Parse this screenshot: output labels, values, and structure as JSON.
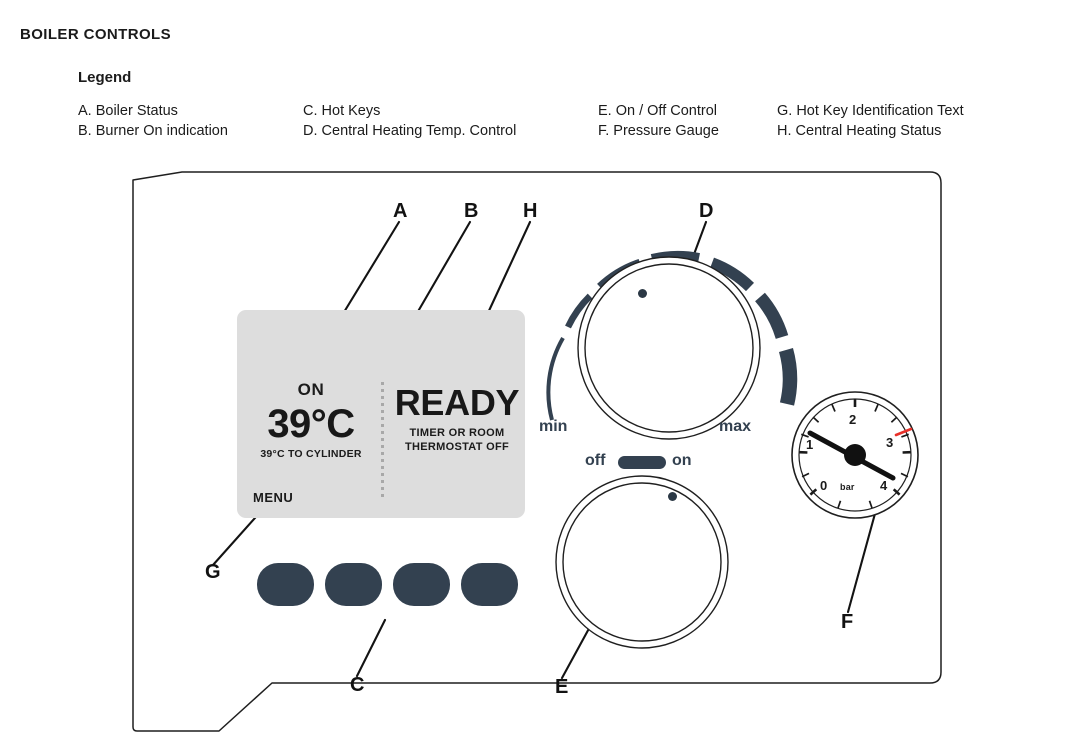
{
  "page": {
    "title": "BOILER CONTROLS",
    "legend_heading": "Legend"
  },
  "legend": {
    "columns": [
      {
        "items": [
          "A. Boiler Status",
          "B. Burner On indication"
        ]
      },
      {
        "items": [
          "C. Hot Keys",
          "D. Central Heating Temp. Control"
        ]
      },
      {
        "items": [
          "E. On / Off Control",
          "F. Pressure Gauge"
        ]
      },
      {
        "items": [
          "G. Hot Key Identification Text",
          "H. Central Heating Status"
        ]
      }
    ]
  },
  "callouts": [
    {
      "letter": "A",
      "target": "boiler-status-icon"
    },
    {
      "letter": "B",
      "target": "burner-on-indication"
    },
    {
      "letter": "C",
      "target": "hot-keys"
    },
    {
      "letter": "D",
      "target": "central-heating-temp-control"
    },
    {
      "letter": "E",
      "target": "on-off-control"
    },
    {
      "letter": "F",
      "target": "pressure-gauge"
    },
    {
      "letter": "G",
      "target": "hot-key-identification-text"
    },
    {
      "letter": "H",
      "target": "central-heating-status"
    }
  ],
  "display": {
    "icons": [
      {
        "name": "hot-water-tap-icon",
        "color": "#3e96cc"
      },
      {
        "name": "burner-flame-icon",
        "color": "#2b3239"
      },
      {
        "name": "radiator-heating-icon",
        "color": "#ee6a2b"
      }
    ],
    "hot_water_status": "ON",
    "temperature": "39°C",
    "temperature_sub": "39°C TO CYLINDER",
    "heating_status": "READY",
    "heating_substatus_line1": "TIMER OR ROOM",
    "heating_substatus_line2": "THERMOSTAT OFF",
    "menu_label": "MENU"
  },
  "controls": {
    "ch_temp_knob": {
      "min_label": "min",
      "max_label": "max",
      "indicator_angle_deg": -18
    },
    "on_off_knob": {
      "off_label": "off",
      "on_label": "on",
      "indicator_angle_deg": 40
    },
    "hot_keys": {
      "count": 4
    }
  },
  "pressure_gauge": {
    "unit_label": "bar",
    "ticks": [
      "0",
      "1",
      "2",
      "3",
      "4"
    ],
    "needle_value": 1.1,
    "red_mark_value": 3.2,
    "red_mark_color": "#e8312a"
  },
  "colors": {
    "dark": "#334150",
    "outline": "#1a1a1a",
    "lcd_background": "#dddddd",
    "accent_blue": "#3e96cc",
    "accent_orange": "#ee6a2b"
  }
}
